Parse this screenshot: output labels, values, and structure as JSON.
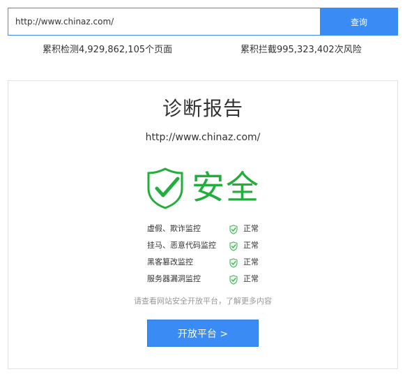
{
  "search": {
    "url_value": "http://www.chinaz.com/",
    "button_label": "查询"
  },
  "stats": {
    "scanned_pages": "累积检测4,929,862,105个页面",
    "blocked_risks": "累积拦截995,323,402次风险"
  },
  "report": {
    "title": "诊断报告",
    "url": "http://www.chinaz.com/",
    "verdict": "安全",
    "checks": [
      {
        "label": "虚假、欺诈监控",
        "status": "正常"
      },
      {
        "label": "挂马、恶意代码监控",
        "status": "正常"
      },
      {
        "label": "黑客篡改监控",
        "status": "正常"
      },
      {
        "label": "服务器漏洞监控",
        "status": "正常"
      }
    ],
    "hint": "请查看网站安全开放平台，了解更多内容",
    "open_button": "开放平台 >"
  },
  "colors": {
    "accent": "#3b8bf5",
    "safe_green": "#21ae3c",
    "check_green": "#36b34a",
    "hint_gray": "#999999",
    "card_border": "#e2e2e2"
  },
  "icons": {
    "verdict": "shield-check-icon",
    "check": "shield-check-small-icon"
  }
}
